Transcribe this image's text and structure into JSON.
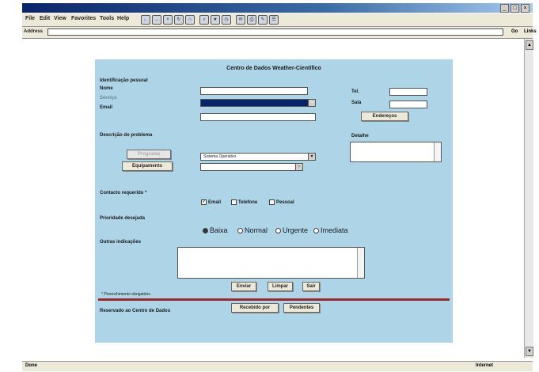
{
  "browser": {
    "menu": [
      "File",
      "Edit",
      "View",
      "Favorites",
      "Tools",
      "Help"
    ],
    "address_label": "Address",
    "go_label": "Go",
    "links_label": "Links",
    "status_left": "Done",
    "status_right": "Internet"
  },
  "form": {
    "title": "Centro de Dados Weather-Científico",
    "section_id": "Identificação pessoal",
    "nome_label": "Nome",
    "servico_label": "Serviço",
    "email_label": "Email",
    "tel_label": "Tel.",
    "sala_label": "Sala",
    "enderecos_btn": "Endereços",
    "descricao_label": "Descrição do problema",
    "detalhe_label": "Detalhe",
    "programa_btn": "Programa",
    "equipamento_btn": "Equipamento",
    "sistema_value": "Sistema Operativo",
    "equip_value": "",
    "contacto_label": "Contacto requerido *",
    "contacto_options": [
      {
        "label": "Email",
        "checked": true
      },
      {
        "label": "Telefone",
        "checked": false
      },
      {
        "label": "Pessoal",
        "checked": false
      }
    ],
    "prioridade_label": "Prioridade desejada",
    "prioridade_options": [
      {
        "label": "Baixa",
        "checked": true
      },
      {
        "label": "Normal",
        "checked": false
      },
      {
        "label": "Urgente",
        "checked": false
      },
      {
        "label": "Imediata",
        "checked": false
      }
    ],
    "outras_label": "Outras indicações",
    "enviar_btn": "Enviar",
    "limpar_btn": "Limpar",
    "sair_btn": "Sair",
    "required_note": "* Preenchimento obrigatório",
    "reservado_label": "Reservado ao Centro de Dados",
    "recebido_btn": "Recebido por",
    "pendentes_btn": "Pendentes"
  }
}
